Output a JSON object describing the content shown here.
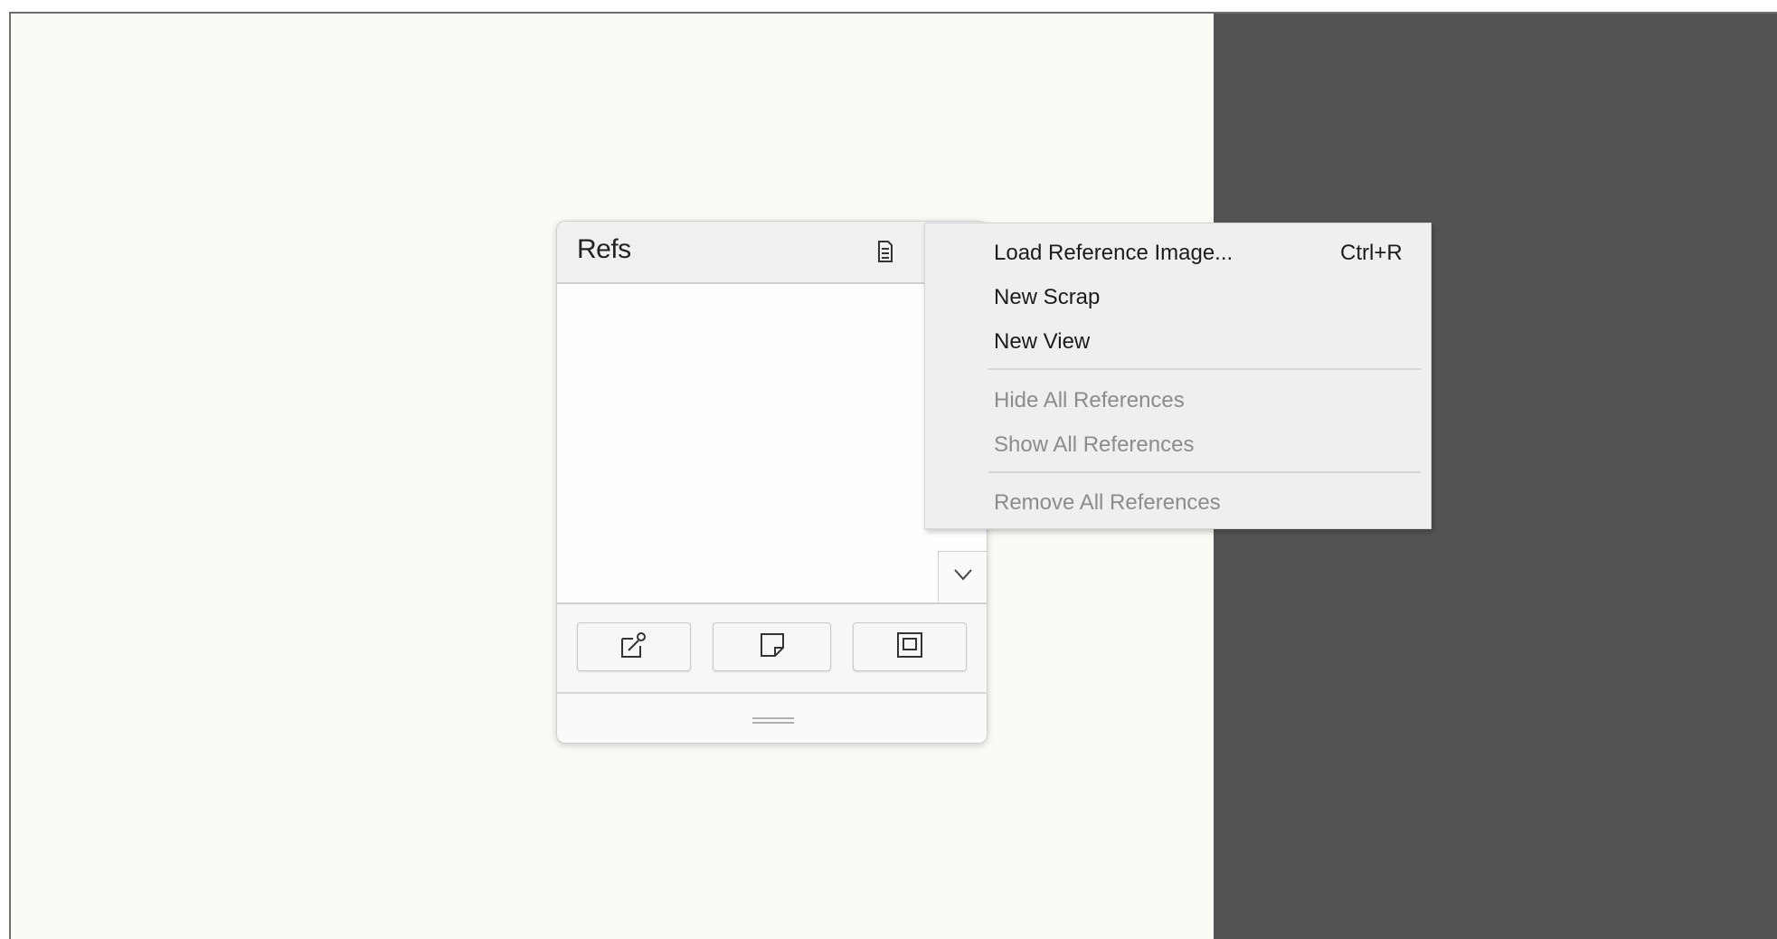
{
  "panel": {
    "title": "Refs",
    "menu_icon": "menu-list-icon",
    "scroll_icon": "chevron-down-icon",
    "buttons": [
      {
        "icon": "load-reference-icon"
      },
      {
        "icon": "new-scrap-icon"
      },
      {
        "icon": "new-view-icon"
      }
    ],
    "grip_icon": "resize-grip-icon"
  },
  "context_menu": {
    "items": [
      {
        "label": "Load Reference Image...",
        "shortcut": "Ctrl+R",
        "enabled": true
      },
      {
        "label": "New Scrap",
        "shortcut": "",
        "enabled": true
      },
      {
        "label": "New View",
        "shortcut": "",
        "enabled": true
      },
      {
        "label": "Hide All References",
        "shortcut": "",
        "enabled": false
      },
      {
        "label": "Show All References",
        "shortcut": "",
        "enabled": false
      },
      {
        "label": "Remove All References",
        "shortcut": "",
        "enabled": false
      }
    ]
  },
  "colors": {
    "canvas": "#fbfaf5",
    "dark_area": "#545354",
    "menu_bg": "#efefef",
    "disabled_text": "#8c8c8c"
  }
}
